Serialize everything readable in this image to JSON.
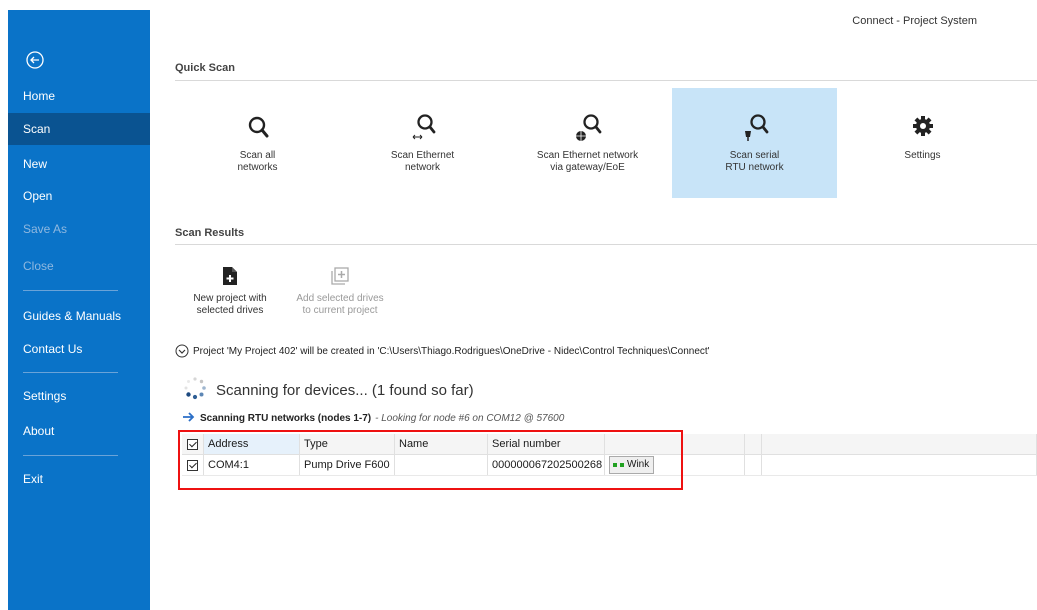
{
  "window": {
    "title": "Connect - Project System"
  },
  "sidebar": {
    "items": [
      {
        "label": "Home"
      },
      {
        "label": "Scan"
      },
      {
        "label": "New"
      },
      {
        "label": "Open"
      },
      {
        "label": "Save As"
      },
      {
        "label": "Close"
      },
      {
        "label": "Guides & Manuals"
      },
      {
        "label": "Contact Us"
      },
      {
        "label": "Settings"
      },
      {
        "label": "About"
      },
      {
        "label": "Exit"
      }
    ]
  },
  "quick_scan": {
    "title": "Quick Scan",
    "tiles": [
      {
        "label1": "Scan all",
        "label2": "networks",
        "icon": "magnifier-icon"
      },
      {
        "label1": "Scan Ethernet",
        "label2": "network",
        "icon": "magnifier-ethernet-icon"
      },
      {
        "label1": "Scan Ethernet network",
        "label2": "via gateway/EoE",
        "icon": "magnifier-globe-icon"
      },
      {
        "label1": "Scan serial",
        "label2": "RTU network",
        "icon": "magnifier-serial-icon"
      },
      {
        "label1": "Settings",
        "label2": "",
        "icon": "gear-icon"
      }
    ]
  },
  "scan_results": {
    "title": "Scan Results",
    "actions": [
      {
        "label1": "New project with",
        "label2": "selected drives"
      },
      {
        "label1": "Add selected drives",
        "label2": "to current project"
      }
    ],
    "project_message": "Project 'My Project 402' will be created in 'C:\\Users\\Thiago.Rodrigues\\OneDrive - Nidec\\Control Techniques\\Connect'",
    "scanning_text": "Scanning for devices... (1 found so far)",
    "rtu_bold": "Scanning RTU networks (nodes 1-7)",
    "rtu_italic": " - Looking for node #6 on COM12 @ 57600"
  },
  "table": {
    "columns": [
      "Address",
      "Type",
      "Name",
      "Serial number"
    ],
    "rows": [
      {
        "address": "COM4:1",
        "type": "Pump Drive F600",
        "name": "",
        "serial": "000000067202500268",
        "wink": "Wink"
      }
    ]
  },
  "colors": {
    "sidebar": "#0a73c8",
    "sidebar_active": "#0a5391",
    "tile_selected": "#c8e4f8",
    "highlight": "#ee1111"
  }
}
